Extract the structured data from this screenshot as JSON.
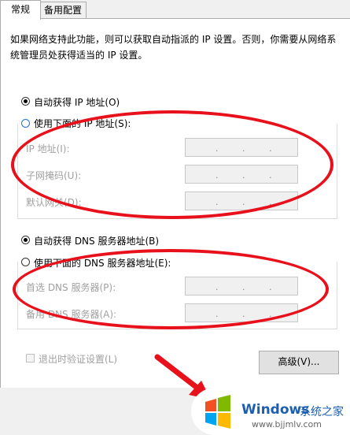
{
  "tabs": [
    {
      "label": "常规"
    },
    {
      "label": "备用配置"
    }
  ],
  "intro_text": "如果网络支持此功能，则可以获取自动指派的 IP 设置。否则，你需要从网络系统管理员处获得适当的 IP 设置。",
  "ip": {
    "auto_label": "自动获得 IP 地址(O)",
    "manual_label": "使用下面的 IP 地址(S):",
    "fields": [
      {
        "label": "IP 地址(I):",
        "value": ". . ."
      },
      {
        "label": "子网掩码(U):",
        "value": ". . ."
      },
      {
        "label": "默认网关(D):",
        "value": ". . ."
      }
    ],
    "selected": "auto"
  },
  "dns": {
    "auto_label": "自动获得 DNS 服务器地址(B)",
    "manual_label": "使用下面的 DNS 服务器地址(E):",
    "fields": [
      {
        "label": "首选 DNS 服务器(P):",
        "value": ". . ."
      },
      {
        "label": "备用 DNS 服务器(A):",
        "value": ". . ."
      }
    ],
    "selected": "auto"
  },
  "validate_label": "退出时验证设置(L)",
  "advanced_button": "高级(V)...",
  "annotation_color": "#e8101a",
  "watermark": {
    "brand": "Windows",
    "brand_cn": "系统之家",
    "url": "www.bjjmlv.com"
  }
}
